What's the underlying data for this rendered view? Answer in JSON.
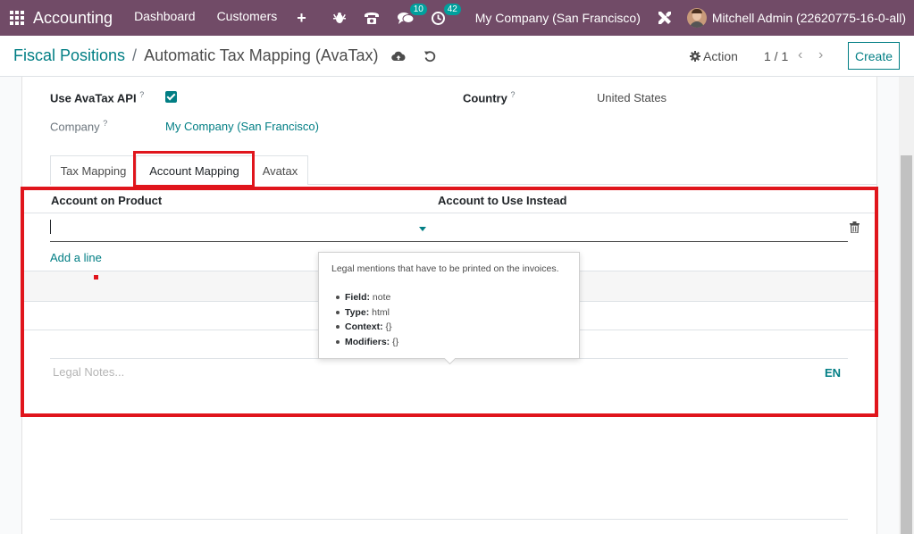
{
  "navbar": {
    "app_name": "Accounting",
    "menu": [
      "Dashboard",
      "Customers"
    ],
    "plus": "+",
    "messages_count": "10",
    "activities_count": "42",
    "company": "My Company (San Francisco)",
    "user": "Mitchell Admin (22620775-16-0-all)",
    "bg_color": "#714b67"
  },
  "control_panel": {
    "breadcrumb_parent": "Fiscal Positions",
    "breadcrumb_separator": "/",
    "breadcrumb_current": "Automatic Tax Mapping (AvaTax)",
    "action_label": "Action",
    "pager": "1 / 1",
    "create_label": "Create"
  },
  "form": {
    "use_avatax_label": "Use AvaTax API",
    "use_avatax_checked": true,
    "help_mark": "?",
    "country_label": "Country",
    "country_value": "United States",
    "company_label": "Company",
    "company_value": "My Company (San Francisco)"
  },
  "tabs": [
    "Tax Mapping",
    "Account Mapping",
    "Avatax"
  ],
  "active_tab": "Account Mapping",
  "account_mapping": {
    "col_product": "Account on Product",
    "col_instead": "Account to Use Instead",
    "add_line": "Add a line"
  },
  "legal_notes": {
    "placeholder": "Legal Notes...",
    "lang": "EN"
  },
  "tooltip": {
    "description": "Legal mentions that have to be printed on the invoices.",
    "field_label": "Field:",
    "field_value": "note",
    "type_label": "Type:",
    "type_value": "html",
    "context_label": "Context:",
    "context_value": "{}",
    "modifiers_label": "Modifiers:",
    "modifiers_value": "{}"
  },
  "colors": {
    "accent": "#017e84",
    "highlight": "#e0151c"
  }
}
